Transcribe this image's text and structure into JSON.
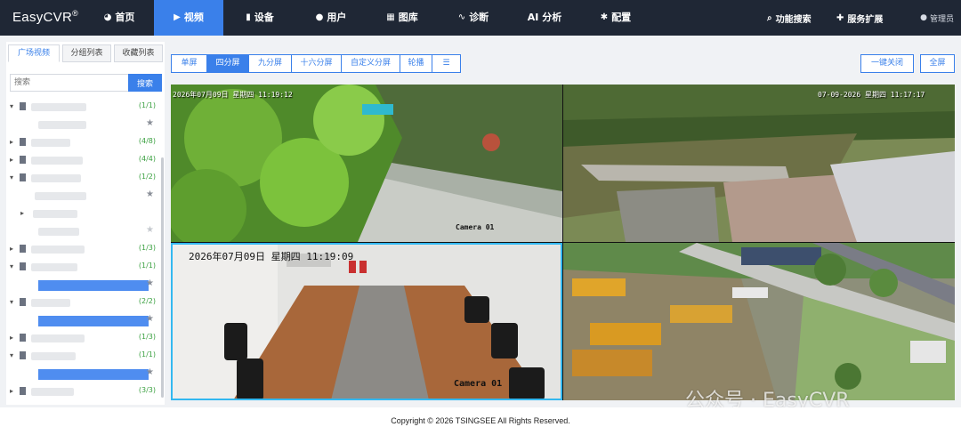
{
  "app": {
    "brand": "EasyCVR",
    "brand_mark": "®"
  },
  "nav": {
    "items": [
      {
        "label": "首页",
        "icon": "dashboard-icon",
        "glyph": "◕"
      },
      {
        "label": "视频",
        "icon": "play-icon",
        "glyph": "▶"
      },
      {
        "label": "设备",
        "icon": "device-icon",
        "glyph": "▮"
      },
      {
        "label": "用户",
        "icon": "user-icon",
        "glyph": "●"
      },
      {
        "label": "图库",
        "icon": "gallery-icon",
        "glyph": "▦"
      },
      {
        "label": "诊断",
        "icon": "pulse-icon",
        "glyph": "∿"
      },
      {
        "label": "AI 分析",
        "icon": "",
        "glyph": ""
      },
      {
        "label": "配置",
        "icon": "gear-icon",
        "glyph": "✱"
      }
    ],
    "function_search": "功能搜索",
    "service_ext": "服务扩展",
    "user": "管理员"
  },
  "sidebar": {
    "tabs": [
      "广场视频",
      "分组列表",
      "收藏列表"
    ],
    "search_placeholder": "搜索",
    "search_button": "搜索",
    "tree": [
      {
        "count": "(1/1)"
      },
      {
        "count": ""
      },
      {
        "count": "(4/8)"
      },
      {
        "count": "(4/4)"
      },
      {
        "count": "(1/2)"
      },
      {
        "count": ""
      },
      {
        "count": ""
      },
      {
        "count": ""
      },
      {
        "count": "(1/3)"
      },
      {
        "count": "(1/1)"
      },
      {
        "count": ""
      },
      {
        "count": "(2/2)"
      },
      {
        "count": ""
      },
      {
        "count": "(1/3)"
      },
      {
        "count": "(1/1)"
      },
      {
        "count": ""
      },
      {
        "count": "(3/3)"
      }
    ]
  },
  "toolbar": {
    "layouts": [
      "单屏",
      "四分屏",
      "九分屏",
      "十六分屏",
      "自定义分屏",
      "轮播"
    ],
    "close_all": "一键关闭",
    "fullscreen": "全屏"
  },
  "video": {
    "cells": [
      {
        "timestamp": "2026年07月09日 星期四 11:19:12",
        "camera": "Camera 01"
      },
      {
        "timestamp": "07-09-2026 星期四 11:17:17",
        "camera": ""
      },
      {
        "timestamp": "2026年07月09日  星期四  11:19:09",
        "camera": "Camera 01"
      },
      {
        "timestamp": "",
        "camera": ""
      }
    ],
    "watermark": "公众号 · EasyCVR"
  },
  "footer": {
    "copyright": "Copyright © 2026 TSINGSEE All Rights Reserved."
  },
  "colors": {
    "nav_bg": "#1f2735",
    "accent": "#3a80ea",
    "selected_border": "#33b8f0",
    "count_green": "#3aa040"
  }
}
